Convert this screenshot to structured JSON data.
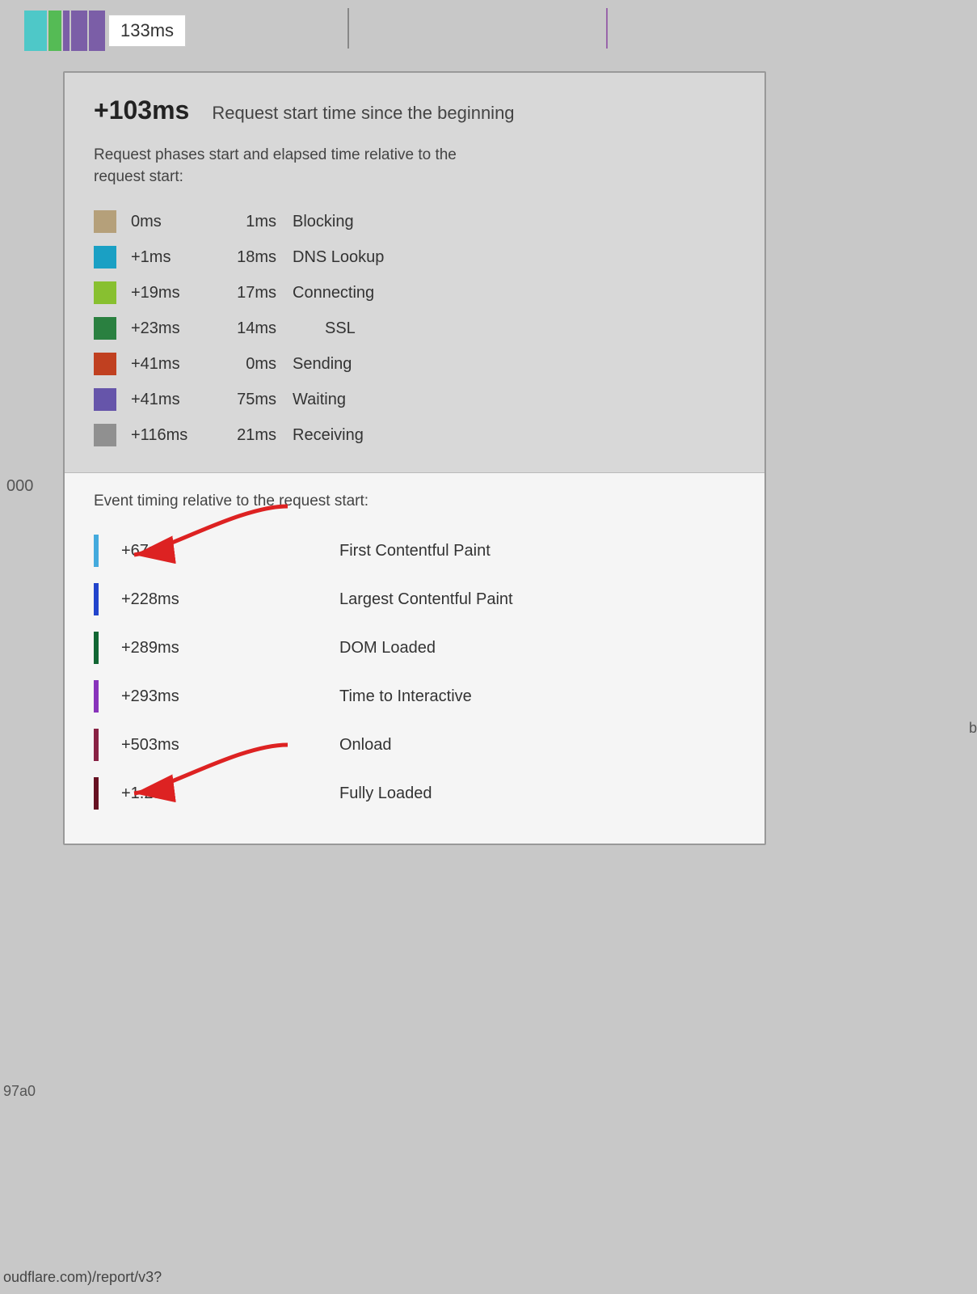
{
  "topBar": {
    "timeBadge": "133ms"
  },
  "tooltip": {
    "header": {
      "time": "+103ms",
      "desc": "Request start time since the beginning"
    },
    "subtext": "Request phases start and elapsed time relative to the\nrequest start:",
    "phases": [
      {
        "color": "#b5a07a",
        "start": "0ms",
        "duration": "1ms",
        "name": "Blocking"
      },
      {
        "color": "#1aa0c4",
        "start": "+1ms",
        "duration": "18ms",
        "name": "DNS Lookup"
      },
      {
        "color": "#88c030",
        "start": "+19ms",
        "duration": "17ms",
        "name": "Connecting"
      },
      {
        "color": "#2a8040",
        "start": "+23ms",
        "duration": "14ms",
        "name": "SSL"
      },
      {
        "color": "#c04020",
        "start": "+41ms",
        "duration": "0ms",
        "name": "Sending"
      },
      {
        "color": "#6655aa",
        "start": "+41ms",
        "duration": "75ms",
        "name": "Waiting"
      },
      {
        "color": "#909090",
        "start": "+116ms",
        "duration": "21ms",
        "name": "Receiving"
      }
    ],
    "eventSubtext": "Event timing relative to the request start:",
    "events": [
      {
        "color": "#44aadd",
        "time": "+67ms",
        "name": "First Contentful Paint",
        "hasArrow": true
      },
      {
        "color": "#2244cc",
        "time": "+228ms",
        "name": "Largest Contentful Paint",
        "hasArrow": false
      },
      {
        "color": "#116633",
        "time": "+289ms",
        "name": "DOM Loaded",
        "hasArrow": false
      },
      {
        "color": "#8833bb",
        "time": "+293ms",
        "name": "Time to Interactive",
        "hasArrow": false
      },
      {
        "color": "#882244",
        "time": "+503ms",
        "name": "Onload",
        "hasArrow": false
      },
      {
        "color": "#661122",
        "time": "+1.2s",
        "name": "Fully Loaded",
        "hasArrow": true
      }
    ]
  },
  "leftLabel": "000",
  "bottomLeft": "97a0",
  "rightPartial": "b",
  "bottomUrl": "oudflare.com)/report/v3?"
}
